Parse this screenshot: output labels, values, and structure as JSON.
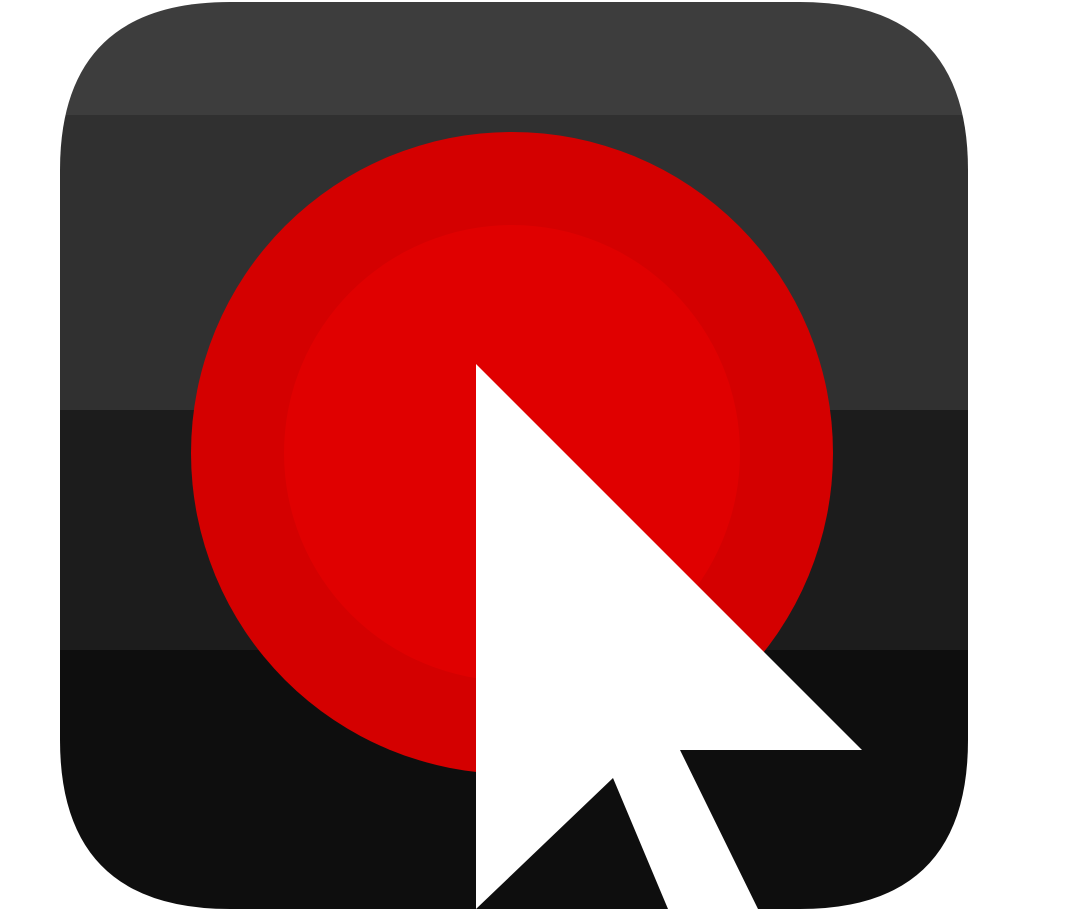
{
  "icon": {
    "name": "screen-recorder-app-icon",
    "colors": {
      "band_top": "#3d3d3d",
      "band_upper": "#303030",
      "band_middle": "#1c1c1c",
      "band_bottom": "#0e0e0e",
      "record_outer": "#d40000",
      "record_inner": "#e00000",
      "cursor": "#ffffff",
      "background": "#ffffff"
    }
  }
}
